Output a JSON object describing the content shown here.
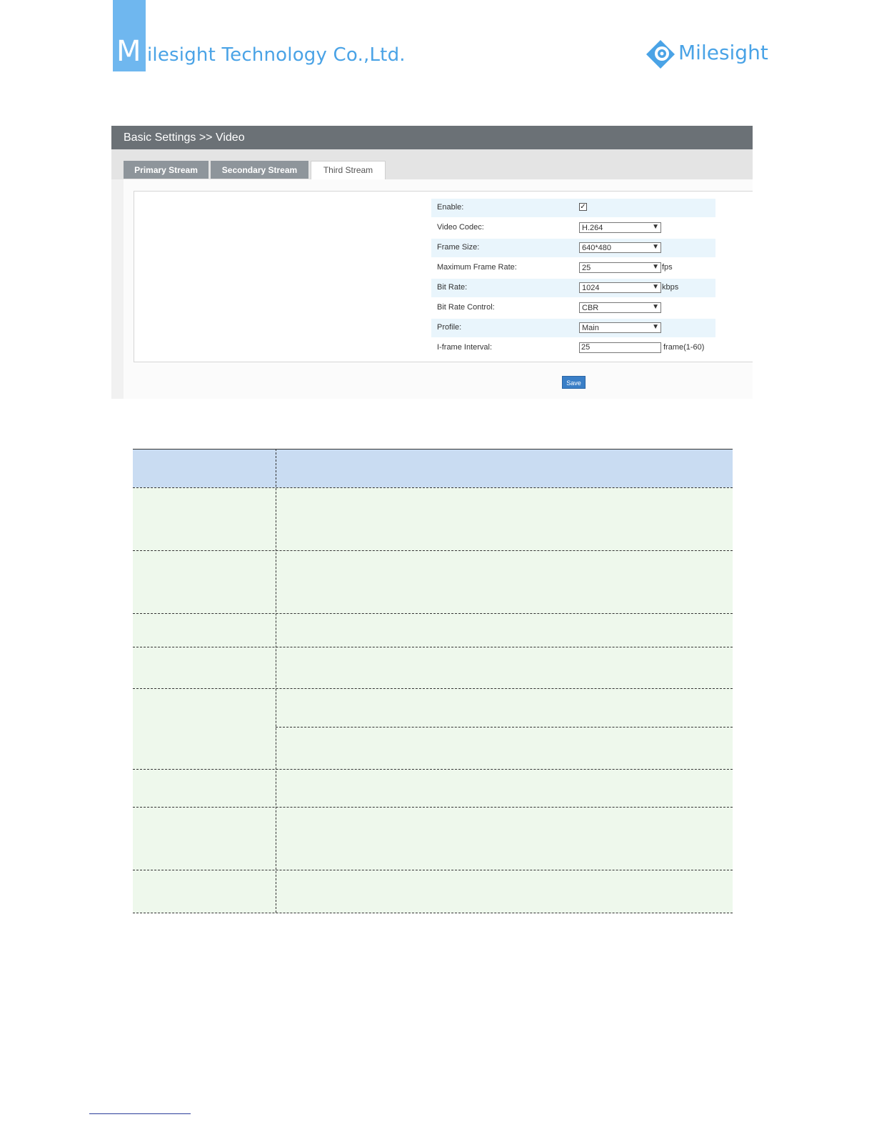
{
  "header": {
    "company_initial": "M",
    "company_rest": "ilesight Technology Co.,Ltd.",
    "logo_text": "Milesight",
    "logo_icon": "milesight-eye-icon",
    "brand_color": "#4aa3e6"
  },
  "panel": {
    "breadcrumb": "Basic Settings >> Video",
    "tabs": [
      {
        "label": "Primary Stream",
        "active": false
      },
      {
        "label": "Secondary Stream",
        "active": false
      },
      {
        "label": "Third Stream",
        "active": true
      }
    ],
    "form": {
      "enable_label": "Enable:",
      "enable_checked": true,
      "video_codec_label": "Video Codec:",
      "video_codec_value": "H.264",
      "frame_size_label": "Frame Size:",
      "frame_size_value": "640*480",
      "max_frame_rate_label": "Maximum Frame Rate:",
      "max_frame_rate_value": "25",
      "max_frame_rate_unit": "fps",
      "bit_rate_label": "Bit Rate:",
      "bit_rate_value": "1024",
      "bit_rate_unit": "kbps",
      "bit_rate_control_label": "Bit Rate Control:",
      "bit_rate_control_value": "CBR",
      "profile_label": "Profile:",
      "profile_value": "Main",
      "iframe_interval_label": "I-frame Interval:",
      "iframe_interval_value": "25",
      "iframe_interval_unit": "frame(1-60)"
    },
    "save_label": "Save",
    "accent_color": "#3a7fc7"
  },
  "table": {
    "header_color": "#c9dcf2",
    "row_color": "#eef8ec"
  }
}
